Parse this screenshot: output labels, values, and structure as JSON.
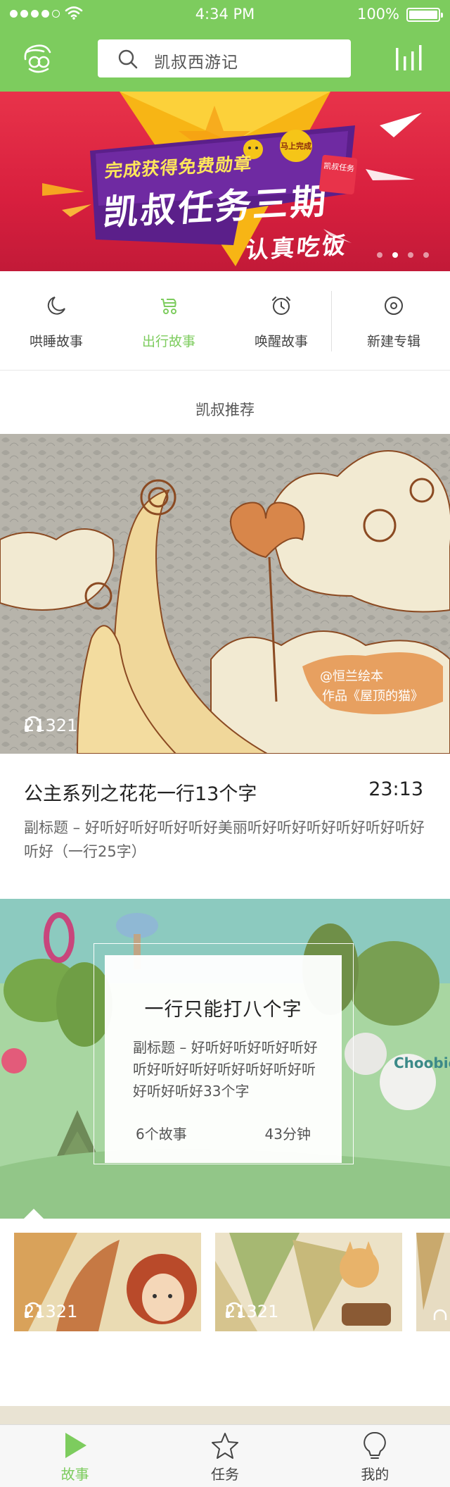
{
  "status_bar": {
    "time": "4:34 PM",
    "battery": "100%"
  },
  "header": {
    "search_text": "凯叔西游记"
  },
  "banner": {
    "line1": "完成获得免费勋章",
    "title": "凯叔任务三期",
    "line3": "认真吃饭",
    "badge": "马上完成",
    "tag": "凯叔任务",
    "dots": 4,
    "active_dot": 2
  },
  "categories": [
    {
      "label": "哄睡故事",
      "icon": "moon-icon",
      "active": false
    },
    {
      "label": "出行故事",
      "icon": "stroller-icon",
      "active": true
    },
    {
      "label": "唤醒故事",
      "icon": "alarm-clock-icon",
      "active": false
    },
    {
      "label": "新建专辑",
      "icon": "disc-icon",
      "active": false
    }
  ],
  "section_title": "凯叔推荐",
  "card1": {
    "plays": "21321",
    "image_caption_line1": "@恒兰绘本",
    "image_caption_line2": "作品《屋顶的猫》",
    "title": "公主系列之花花一行13个字",
    "duration": "23:13",
    "subtitle": "副标题 – 好听好听好听好听好美丽听好听好听好听好听好听好听好（一行25字）"
  },
  "card2": {
    "title": "一行只能打八个字",
    "description": "副标题 – 好听好听好听好听好听好听好听好听好听好听好听好听好听好33个字",
    "story_count": "6个故事",
    "total_duration": "43分钟",
    "image_brand": "Choobie",
    "thumbs": [
      {
        "plays": "21321"
      },
      {
        "plays": "21321"
      }
    ]
  },
  "tabbar": [
    {
      "label": "故事",
      "icon": "play-icon",
      "active": true
    },
    {
      "label": "任务",
      "icon": "star-icon",
      "active": false
    },
    {
      "label": "我的",
      "icon": "profile-icon",
      "active": false
    }
  ],
  "colors": {
    "accent": "#7dcc5e",
    "banner_red": "#d81f3e"
  }
}
